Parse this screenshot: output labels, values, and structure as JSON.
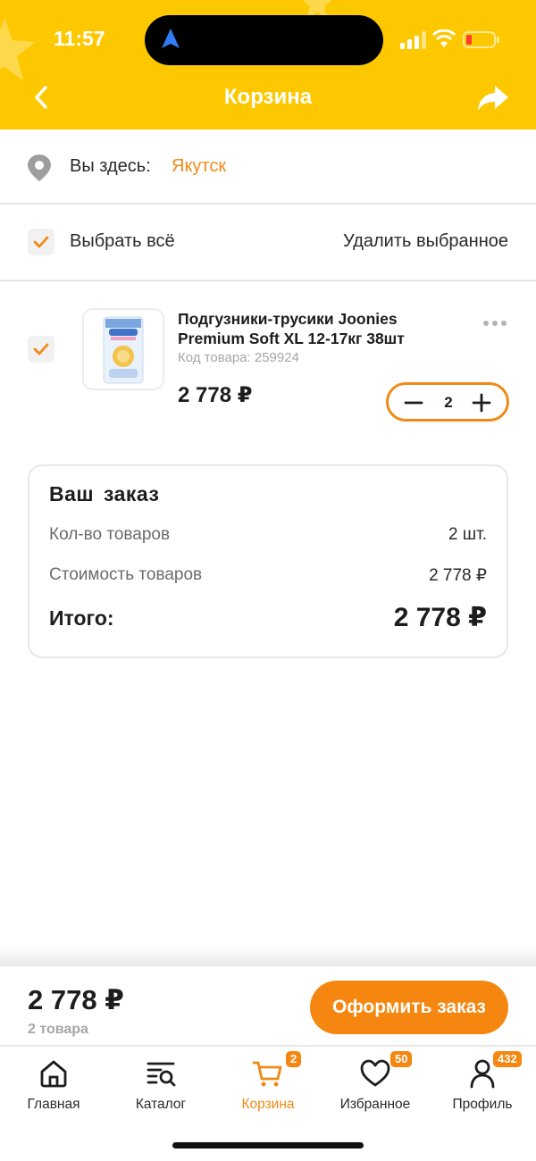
{
  "status": {
    "time": "11:57"
  },
  "header": {
    "title": "Корзина",
    "back_icon": "chevron-left-icon",
    "share_icon": "share-arrow-icon"
  },
  "location": {
    "label": "Вы здесь:",
    "city": "Якутск",
    "icon": "map-pin-icon"
  },
  "selection": {
    "select_all": "Выбрать всё",
    "delete_selected": "Удалить выбранное",
    "checked": true
  },
  "product": {
    "title": "Подгузники-трусики Joonies Premium Soft XL 12-17кг 38шт",
    "code": "Код товара: 259924",
    "price": "2 778 ₽",
    "quantity": "2",
    "checked": true
  },
  "order": {
    "title": "Ваш заказ",
    "count_label": "Кол-во товаров",
    "count_value": "2 шт.",
    "cost_label": "Стоимость товаров",
    "cost_value": "2 778 ₽",
    "total_label": "Итого:",
    "total_value": "2 778 ₽"
  },
  "checkout": {
    "price": "2 778 ₽",
    "count": "2 товара",
    "button": "Оформить заказ"
  },
  "tabs": [
    {
      "label": "Главная",
      "icon": "home-icon",
      "badge": ""
    },
    {
      "label": "Каталог",
      "icon": "catalog-search-icon",
      "badge": ""
    },
    {
      "label": "Корзина",
      "icon": "cart-icon",
      "badge": "2",
      "active": true
    },
    {
      "label": "Избранное",
      "icon": "heart-icon",
      "badge": "50"
    },
    {
      "label": "Профиль",
      "icon": "profile-icon",
      "badge": "432"
    }
  ],
  "colors": {
    "header": "#fdc800",
    "accent": "#f5860f",
    "city": "#f08a16"
  }
}
